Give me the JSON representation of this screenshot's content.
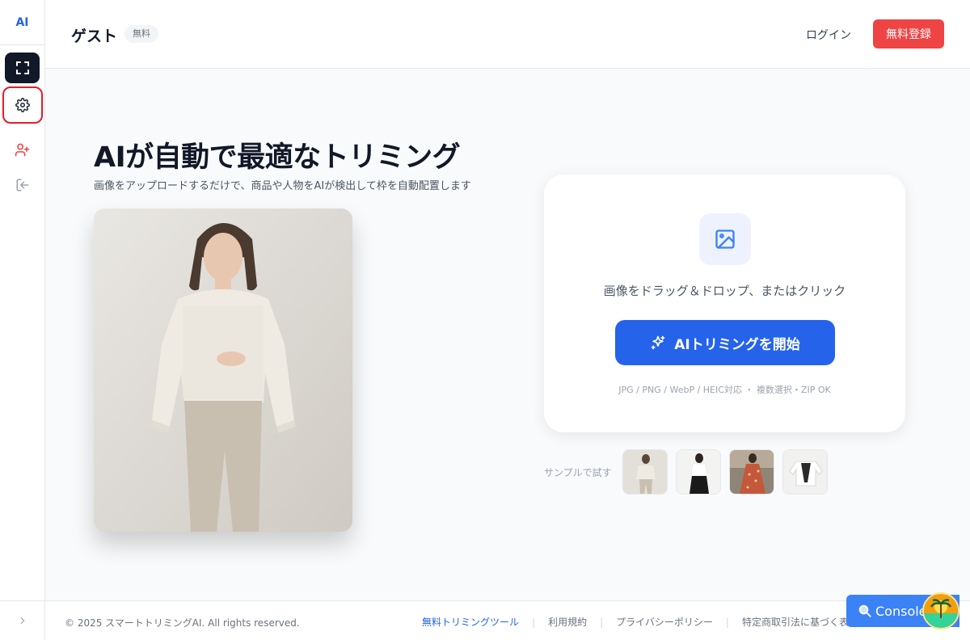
{
  "sidebar": {
    "logo": "AI",
    "items": [
      {
        "name": "trim",
        "icon": "scan-frame-icon",
        "active": true
      },
      {
        "name": "settings",
        "icon": "gear-icon",
        "highlighted": true
      },
      {
        "name": "add-user",
        "icon": "user-plus-icon"
      },
      {
        "name": "logout",
        "icon": "log-in-icon"
      }
    ],
    "expand_icon": "chevron-right-icon"
  },
  "header": {
    "user_name": "ゲスト",
    "plan_badge": "無料",
    "login_label": "ログイン",
    "signup_label": "無料登録"
  },
  "hero": {
    "title": "AIが自動で最適なトリミング",
    "subtitle": "画像をアップロードするだけで、商品や人物をAIが検出して枠を自動配置します"
  },
  "upload": {
    "icon": "image-icon",
    "hint": "画像をドラッグ＆ドロップ、またはクリック",
    "start_label": "AIトリミングを開始",
    "start_icon": "sparkles-icon",
    "formats": "JPG / PNG / WebP / HEIC対応 ・ 複数選択・ZIP OK"
  },
  "samples": {
    "label": "サンプルで試す",
    "items": [
      "sample-1",
      "sample-2",
      "sample-3",
      "sample-4"
    ]
  },
  "footer": {
    "copyright": "© 2025 スマートトリミングAI. All rights reserved.",
    "links": [
      "無料トリミングツール",
      "利用規約",
      "プライバシーポリシー",
      "特定商取引法に基づく表"
    ]
  },
  "console": {
    "label": "Console",
    "icon": "magnifier-icon"
  },
  "colors": {
    "accent": "#2563eb",
    "signup": "#ef4444",
    "highlight_outline": "#e11d2a",
    "sidebar_active": "#111827"
  }
}
